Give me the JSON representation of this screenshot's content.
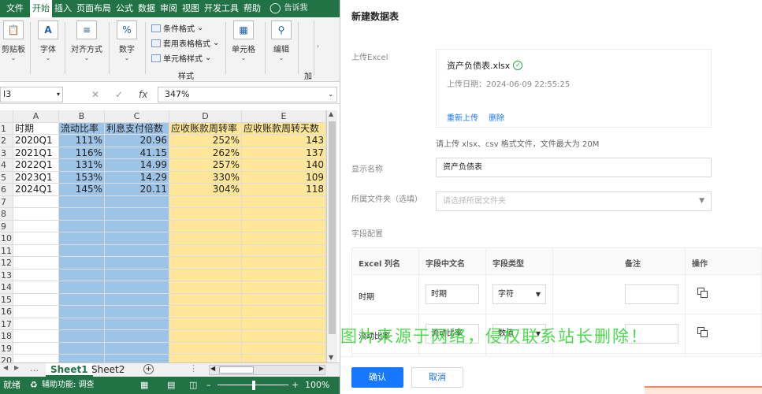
{
  "excel": {
    "tabs": [
      "文件",
      "开始",
      "插入",
      "页面布局",
      "公式",
      "数据",
      "审阅",
      "视图",
      "开发工具",
      "帮助"
    ],
    "active_tab": "开始",
    "tell_me": "告诉我",
    "ribbon": {
      "clipboard": "剪贴板",
      "font": "字体",
      "alignment": "对齐方式",
      "number": "数字",
      "cond_format": "条件格式",
      "table_format": "套用表格格式",
      "cell_style": "单元格样式",
      "styles_group": "样式",
      "cells": "单元格",
      "editing": "编辑",
      "addins": "加"
    },
    "name_box": "I3",
    "formula_value": "347%",
    "columns": [
      "A",
      "B",
      "C",
      "D",
      "E"
    ],
    "headers": [
      "时期",
      "流动比率",
      "利息支付倍数",
      "应收账款周转率",
      "应收账款周转天数"
    ],
    "rows": [
      [
        "2020Q1",
        "111%",
        "20.96",
        "252%",
        "143"
      ],
      [
        "2021Q1",
        "116%",
        "41.15",
        "262%",
        "137"
      ],
      [
        "2022Q1",
        "131%",
        "14.99",
        "257%",
        "140"
      ],
      [
        "2023Q1",
        "153%",
        "14.29",
        "330%",
        "109"
      ],
      [
        "2024Q1",
        "145%",
        "20.11",
        "304%",
        "118"
      ]
    ],
    "row_numbers": [
      "1",
      "2",
      "3",
      "4",
      "5",
      "6",
      "7",
      "8",
      "9",
      "10",
      "11",
      "12",
      "13",
      "14",
      "15",
      "16",
      "17",
      "18",
      "19",
      "20"
    ],
    "sheets": [
      "Sheet1",
      "Sheet2"
    ],
    "active_sheet": "Sheet1",
    "status": {
      "ready": "就绪",
      "accessibility": "辅助功能: 调查",
      "zoom": "100%"
    },
    "colors": {
      "green": "#217346",
      "blue_fill": "#9dc3e6",
      "yellow_fill": "#ffe699"
    }
  },
  "panel": {
    "title": "新建数据表",
    "upload_label": "上传Excel",
    "file_name": "资产负债表.xlsx",
    "upload_date": "上传日期：2024-06-09 22:55:25",
    "reupload": "重新上传",
    "delete": "删除",
    "hint": "请上传 xlsx、csv 格式文件，文件最大为 20M",
    "display_name_label": "显示名称",
    "display_name_value": "资产负债表",
    "folder_label": "所属文件夹（选填）",
    "folder_placeholder": "请选择所属文件夹",
    "fields_label": "字段配置",
    "table_headers": [
      "Excel 列名",
      "字段中文名",
      "字段类型",
      "备注",
      "操作"
    ],
    "fields": [
      {
        "excel_col": "时期",
        "cn_name": "时期",
        "type": "字符"
      },
      {
        "excel_col": "流动比率",
        "cn_name": "流动比率",
        "type": "数值"
      }
    ],
    "ok": "确认",
    "cancel": "取消",
    "accent": "#1677ff"
  },
  "watermark": "图片来源于网络，侵权联系站长删除！"
}
